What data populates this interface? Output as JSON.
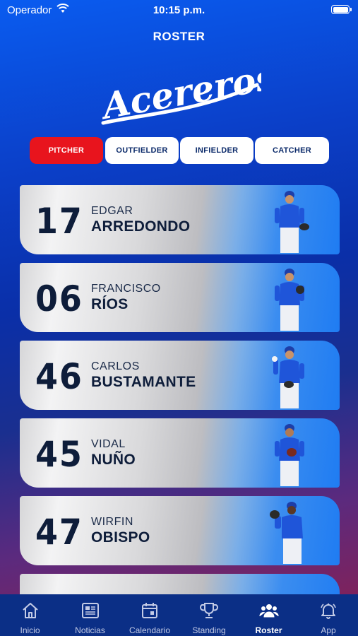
{
  "status_bar": {
    "carrier": "Operador",
    "time": "10:15 p.m."
  },
  "header": {
    "title": "ROSTER"
  },
  "logo": {
    "text": "Acereros"
  },
  "filters": [
    {
      "label": "PITCHER",
      "active": true
    },
    {
      "label": "OUTFIELDER",
      "active": false
    },
    {
      "label": "INFIELDER",
      "active": false
    },
    {
      "label": "CATCHER",
      "active": false
    }
  ],
  "players": [
    {
      "number": "17",
      "first_name": "EDGAR",
      "last_name": "ARREDONDO"
    },
    {
      "number": "06",
      "first_name": "FRANCISCO",
      "last_name": "RÍOS"
    },
    {
      "number": "46",
      "first_name": "CARLOS",
      "last_name": "BUSTAMANTE"
    },
    {
      "number": "45",
      "first_name": "VIDAL",
      "last_name": "NUÑO"
    },
    {
      "number": "47",
      "first_name": "WIRFIN",
      "last_name": "OBISPO"
    },
    {
      "number": "",
      "first_name": "",
      "last_name": ""
    }
  ],
  "tab_bar": [
    {
      "label": "Inicio",
      "icon": "home-icon",
      "active": false
    },
    {
      "label": "Noticias",
      "icon": "news-icon",
      "active": false
    },
    {
      "label": "Calendario",
      "icon": "calendar-icon",
      "active": false
    },
    {
      "label": "Standing",
      "icon": "trophy-icon",
      "active": false
    },
    {
      "label": "Roster",
      "icon": "team-icon",
      "active": true
    },
    {
      "label": "App",
      "icon": "bell-icon",
      "active": false
    }
  ],
  "colors": {
    "accent_red": "#e8141d",
    "navy": "#0e1d3a",
    "tab_bar": "#0b2f86"
  }
}
